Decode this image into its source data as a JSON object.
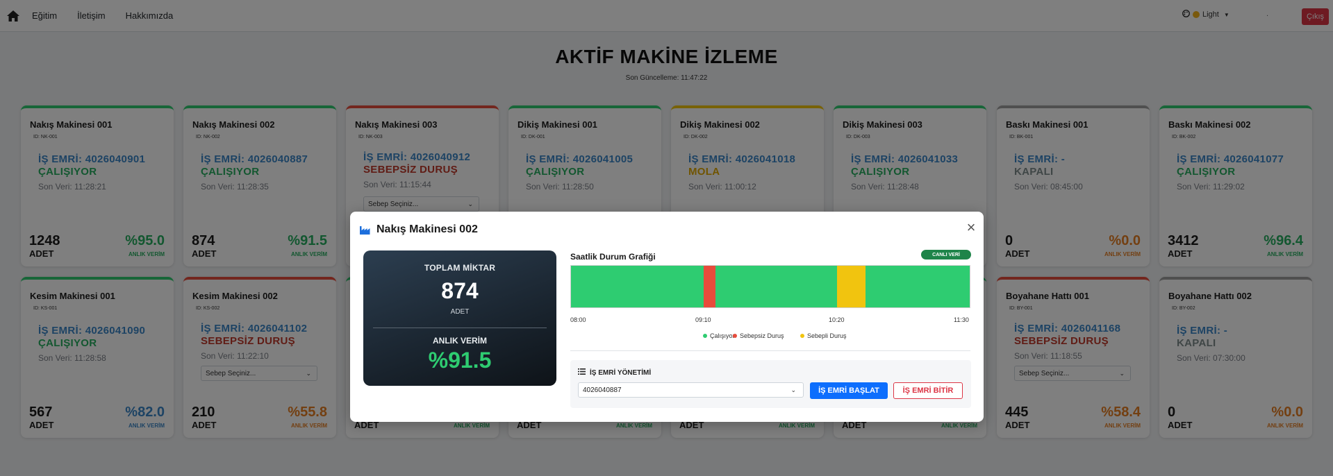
{
  "nav": {
    "links": [
      "Eğitim",
      "İletişim",
      "Hakkımızda"
    ],
    "theme_label": "Light",
    "extra": ".",
    "logout_label": "Çıkış"
  },
  "header": {
    "title": "AKTİF MAKİNE İZLEME",
    "last_update": "Son Güncelleme: 11:47:22"
  },
  "machines": [
    {
      "name": "Nakış Makinesi 001",
      "id": "ID: NK-001",
      "work_order": "İŞ EMRİ: 4026040901",
      "status": "ÇALIŞIYOR",
      "last_data": "Son Veri: 11:28:21",
      "qty": "1248",
      "unit": "ADET",
      "efficiency": "%95.0",
      "eff_label": "ANLIK VERİM",
      "status_color": "green"
    },
    {
      "name": "Nakış Makinesi 002",
      "id": "ID: NK-002",
      "work_order": "İŞ EMRİ: 4026040887",
      "status": "ÇALIŞIYOR",
      "last_data": "Son Veri: 11:28:35",
      "qty": "874",
      "unit": "ADET",
      "efficiency": "%91.5",
      "eff_label": "ANLIK VERİM",
      "status_color": "green"
    },
    {
      "name": "Nakış Makinesi 003",
      "id": "ID: NK-003",
      "work_order": "İŞ EMRİ: 4026040912",
      "status": "SEBEPSİZ DURUŞ",
      "last_data": "Son Veri: 11:15:44",
      "select_placeholder": "Sebep Seçiniz...",
      "status_color": "red"
    },
    {
      "name": "Dikiş Makinesi 001",
      "id": "ID: DK-001",
      "work_order": "İŞ EMRİ: 4026041005",
      "status": "ÇALIŞIYOR",
      "last_data": "Son Veri: 11:28:50",
      "status_color": "green"
    },
    {
      "name": "Dikiş Makinesi 002",
      "id": "ID: DK-002",
      "work_order": "İŞ EMRİ: 4026041018",
      "status": "MOLA",
      "last_data": "Son Veri: 11:00:12",
      "status_color": "yellow"
    },
    {
      "name": "Dikiş Makinesi 003",
      "id": "ID: DK-003",
      "work_order": "İŞ EMRİ: 4026041033",
      "status": "ÇALIŞIYOR",
      "last_data": "Son Veri: 11:28:48",
      "status_color": "green"
    },
    {
      "name": "Baskı Makinesi 001",
      "id": "ID: BK-001",
      "work_order": "İŞ EMRİ: -",
      "status": "KAPALI",
      "last_data": "Son Veri: 08:45:00",
      "qty": "0",
      "unit": "ADET",
      "efficiency": "%0.0",
      "eff_label": "ANLIK VERİM",
      "status_color": "gray"
    },
    {
      "name": "Baskı Makinesi 002",
      "id": "ID: BK-002",
      "work_order": "İŞ EMRİ: 4026041077",
      "status": "ÇALIŞIYOR",
      "last_data": "Son Veri: 11:29:02",
      "qty": "3412",
      "unit": "ADET",
      "efficiency": "%96.4",
      "eff_label": "ANLIK VERİM",
      "status_color": "green"
    },
    {
      "name": "Kesim Makinesi 001",
      "id": "ID: KS-001",
      "work_order": "İŞ EMRİ: 4026041090",
      "status": "ÇALIŞIYOR",
      "last_data": "Son Veri: 11:28:58",
      "qty": "567",
      "unit": "ADET",
      "efficiency": "%82.0",
      "eff_label": "ANLIK VERİM",
      "status_color": "green"
    },
    {
      "name": "Kesim Makinesi 002",
      "id": "ID: KS-002",
      "work_order": "İŞ EMRİ: 4026041102",
      "status": "SEBEPSİZ DURUŞ",
      "last_data": "Son Veri: 11:22:10",
      "select_placeholder": "Sebep Seçiniz...",
      "qty": "210",
      "unit": "ADET",
      "efficiency": "%55.8",
      "eff_label": "ANLIK VERİM",
      "status_color": "red"
    },
    {
      "unit": "ADET",
      "eff_label": "ANLIK VERİM"
    },
    {
      "unit": "ADET",
      "eff_label": "ANLIK VERİM"
    },
    {
      "unit": "ADET",
      "eff_label": "ANLIK VERİM"
    },
    {
      "unit": "ADET",
      "eff_label": "ANLIK VERİM"
    },
    {
      "name": "Boyahane Hattı 001",
      "id": "ID: BY-001",
      "work_order": "İŞ EMRİ: 4026041168",
      "status": "SEBEPSİZ DURUŞ",
      "last_data": "Son Veri: 11:18:55",
      "select_placeholder": "Sebep Seçiniz...",
      "qty": "445",
      "unit": "ADET",
      "efficiency": "%58.4",
      "eff_label": "ANLIK VERİM",
      "status_color": "red"
    },
    {
      "name": "Boyahane Hattı 002",
      "id": "ID: BY-002",
      "work_order": "İŞ EMRİ: -",
      "status": "KAPALI",
      "last_data": "Son Veri: 07:30:00",
      "qty": "0",
      "unit": "ADET",
      "efficiency": "%0.0",
      "eff_label": "ANLIK VERİM",
      "status_color": "gray"
    }
  ],
  "modal": {
    "title": "Nakış Makinesi 002",
    "stats": {
      "total_label": "TOPLAM MİKTAR",
      "total": "874",
      "unit": "ADET",
      "eff_label": "ANLIK VERİM",
      "eff": "%91.5"
    },
    "chart_title": "Saatlik Durum Grafiği",
    "live_badge": "CANLI VERİ",
    "timeline": {
      "ticks": [
        "08:00",
        "09:10",
        "10:20",
        "11:30"
      ],
      "segments": [
        {
          "state": "Çalışıyor",
          "start": "08:00",
          "end": "09:10"
        },
        {
          "state": "Sebepsiz Duruş",
          "start": "09:10",
          "end": "09:16"
        },
        {
          "state": "Çalışıyor",
          "start": "09:16",
          "end": "10:20"
        },
        {
          "state": "Sebepli Duruş",
          "start": "10:20",
          "end": "10:35"
        },
        {
          "state": "Çalışıyor",
          "start": "10:35",
          "end": "11:30"
        }
      ],
      "legend": [
        {
          "label": "Çalışıyor",
          "color": "#2ecc71"
        },
        {
          "label": "Sebepsiz Duruş",
          "color": "#e74c3c"
        },
        {
          "label": "Sebepli Duruş",
          "color": "#f1c40f"
        }
      ]
    },
    "work_order": {
      "heading": "İŞ EMRİ YÖNETİMİ",
      "selected": "4026040887",
      "start_label": "İŞ EMRİ BAŞLAT",
      "end_label": "İŞ EMRİ BİTİR"
    }
  },
  "colors": {
    "running": "#2ecc71",
    "unplanned_stop": "#e74c3c",
    "planned_stop": "#f1c40f",
    "primary": "#0d6efd",
    "danger": "#dc3545"
  }
}
